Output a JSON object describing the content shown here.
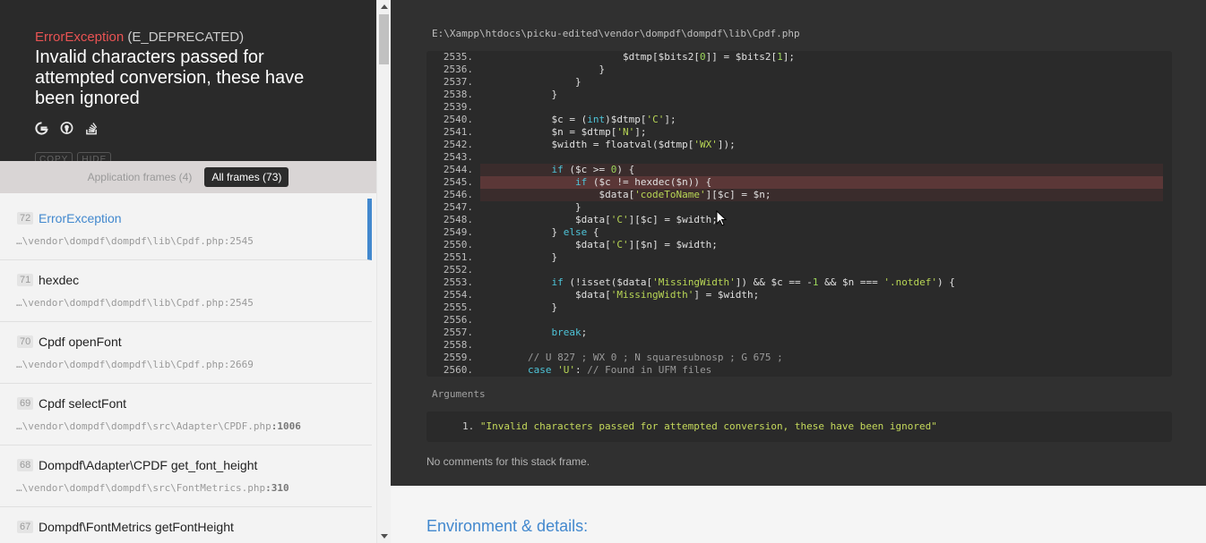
{
  "exception": {
    "class": "ErrorException",
    "type": " (E_DEPRECATED)",
    "message": "Invalid characters passed for attempted conversion, these have been ignored",
    "icons": [
      "google-icon",
      "duckduckgo-icon",
      "stackoverflow-icon"
    ],
    "ghost_buttons": [
      "COPY",
      "HIDE"
    ]
  },
  "frame_tabs": {
    "application": "Application frames (4)",
    "all": "All frames (73)"
  },
  "frames": [
    {
      "index": "72",
      "function": "ErrorException",
      "file": "…\\vendor\\dompdf\\dompdf\\lib\\Cpdf.php",
      "line": ":2545"
    },
    {
      "index": "71",
      "function": "hexdec",
      "file": "…\\vendor\\dompdf\\dompdf\\lib\\Cpdf.php",
      "line": ":2545"
    },
    {
      "index": "70",
      "function": "Cpdf openFont",
      "file": "…\\vendor\\dompdf\\dompdf\\lib\\Cpdf.php",
      "line": ":2669"
    },
    {
      "index": "69",
      "function": "Cpdf selectFont",
      "file": "…\\vendor\\dompdf\\dompdf\\src\\Adapter\\CPDF.php",
      "line": ":1006"
    },
    {
      "index": "68",
      "function": "Dompdf\\Adapter\\CPDF get_font_height",
      "file": "…\\vendor\\dompdf\\dompdf\\src\\FontMetrics.php",
      "line": ":310"
    },
    {
      "index": "67",
      "function": "Dompdf\\FontMetrics getFontHeight",
      "file": "",
      "line": ""
    }
  ],
  "code_view": {
    "file_path": "E:\\Xampp\\htdocs\\picku-edited\\vendor\\dompdf\\dompdf\\lib\\Cpdf.php",
    "lines": [
      {
        "no": "2535.",
        "code": "                        $dtmp[$bits2[0]] = $bits2[1];"
      },
      {
        "no": "2536.",
        "code": "                    }"
      },
      {
        "no": "2537.",
        "code": "                }"
      },
      {
        "no": "2538.",
        "code": "            }"
      },
      {
        "no": "2539.",
        "code": ""
      },
      {
        "no": "2540.",
        "code": "            $c = (int)$dtmp['C'];"
      },
      {
        "no": "2541.",
        "code": "            $n = $dtmp['N'];"
      },
      {
        "no": "2542.",
        "code": "            $width = floatval($dtmp['WX']);"
      },
      {
        "no": "2543.",
        "code": ""
      },
      {
        "no": "2544.",
        "code": "            if ($c >= 0) {"
      },
      {
        "no": "2545.",
        "code": "                if ($c != hexdec($n)) {"
      },
      {
        "no": "2546.",
        "code": "                    $data['codeToName'][$c] = $n;"
      },
      {
        "no": "2547.",
        "code": "                }"
      },
      {
        "no": "2548.",
        "code": "                $data['C'][$c] = $width;"
      },
      {
        "no": "2549.",
        "code": "            } else {"
      },
      {
        "no": "2550.",
        "code": "                $data['C'][$n] = $width;"
      },
      {
        "no": "2551.",
        "code": "            }"
      },
      {
        "no": "2552.",
        "code": ""
      },
      {
        "no": "2553.",
        "code": "            if (!isset($data['MissingWidth']) && $c == -1 && $n === '.notdef') {"
      },
      {
        "no": "2554.",
        "code": "                $data['MissingWidth'] = $width;"
      },
      {
        "no": "2555.",
        "code": "            }"
      },
      {
        "no": "2556.",
        "code": ""
      },
      {
        "no": "2557.",
        "code": "            break;"
      },
      {
        "no": "2558.",
        "code": ""
      },
      {
        "no": "2559.",
        "code": "        // U 827 ; WX 0 ; N squaresubnosp ; G 675 ;"
      },
      {
        "no": "2560.",
        "code": "        case 'U': // Found in UFM files"
      }
    ],
    "highlight_lines": [
      "2544.",
      "2545.",
      "2546."
    ],
    "error_line": "2545."
  },
  "arguments": {
    "label": "Arguments",
    "items": [
      {
        "no": "1.",
        "value": "\"Invalid characters passed for attempted conversion, these have been ignored\""
      }
    ]
  },
  "comments": "No comments for this stack frame.",
  "environment": {
    "title": "Environment & details:"
  }
}
